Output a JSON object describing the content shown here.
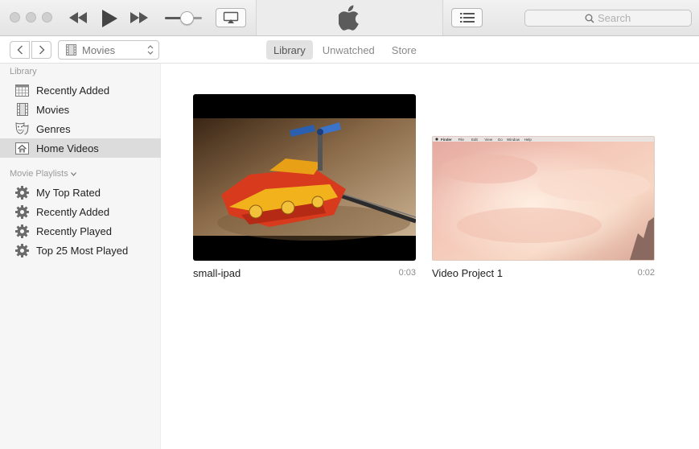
{
  "window": {
    "search_placeholder": "Search"
  },
  "navbar": {
    "media_kind": "Movies",
    "tabs": [
      {
        "label": "Library",
        "active": true
      },
      {
        "label": "Unwatched",
        "active": false
      },
      {
        "label": "Store",
        "active": false
      }
    ]
  },
  "sidebar": {
    "library_heading": "Library",
    "library_items": [
      {
        "label": "Recently Added",
        "icon": "calendar-grid-icon"
      },
      {
        "label": "Movies",
        "icon": "film-strip-icon"
      },
      {
        "label": "Genres",
        "icon": "theater-masks-icon"
      },
      {
        "label": "Home Videos",
        "icon": "house-icon",
        "selected": true
      }
    ],
    "playlists_heading": "Movie Playlists",
    "playlist_items": [
      {
        "label": "My Top Rated",
        "icon": "gear-icon"
      },
      {
        "label": "Recently Added",
        "icon": "gear-icon"
      },
      {
        "label": "Recently Played",
        "icon": "gear-icon"
      },
      {
        "label": "Top 25 Most Played",
        "icon": "gear-icon"
      }
    ]
  },
  "videos": [
    {
      "title": "small-ipad",
      "duration": "0:03"
    },
    {
      "title": "Video Project 1",
      "duration": "0:02"
    }
  ],
  "thumb_menubar": [
    "Finder",
    "File",
    "Edit",
    "View",
    "Go",
    "Window",
    "Help"
  ],
  "volume_level": 0.6
}
